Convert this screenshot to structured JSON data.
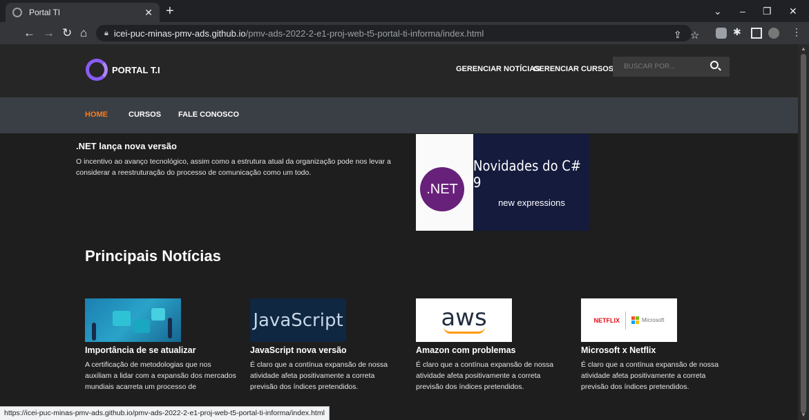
{
  "browser": {
    "tab_title": "Portal TI",
    "url_host": "icei-puc-minas-pmv-ads.github.io",
    "url_path": "/pmv-ads-2022-2-e1-proj-web-t5-portal-ti-informa/index.html",
    "status_url": "https://icei-puc-minas-pmv-ads.github.io/pmv-ads-2022-2-e1-proj-web-t5-portal-ti-informa/index.html"
  },
  "header": {
    "logo_text": "PORTAL T.I",
    "links": [
      "GERENCIAR NOTÍCIAS",
      "GERENCIAR CURSOS"
    ],
    "search_placeholder": "BUSCAR POR..."
  },
  "subnav": {
    "items": [
      "HOME",
      "CURSOS",
      "FALE CONOSCO"
    ],
    "active": "HOME"
  },
  "feature": {
    "title": ".NET lança nova versão",
    "text": "O incentivo ao avanço tecnológico, assim como a estrutura atual da organização pode nos levar a considerar a reestruturação do processo de comunicação como um todo."
  },
  "banner": {
    "badge": ".NET",
    "title": "Novidades do C# 9",
    "subtitle": "new expressions"
  },
  "section_title": "Principais Notícias",
  "cards": [
    {
      "title": "Importância de se atualizar",
      "text": "A certificação de metodologias que nos auxiliam a lidar com a expansão dos mercados mundiais acarreta um processo de"
    },
    {
      "title": "JavaScript nova versão",
      "image_text": "JavaScript",
      "text": "É claro que a contínua expansão de nossa atividade afeta positivamente a correta previsão dos índices pretendidos."
    },
    {
      "title": "Amazon com problemas",
      "image_text": "aws",
      "text": "É claro que a contínua expansão de nossa atividade afeta positivamente a correta previsão dos índices pretendidos."
    },
    {
      "title": "Microsoft x Netflix",
      "image_text_1": "NETFLIX",
      "image_text_2": "Microsoft",
      "text": "É claro que a contínua expansão de nossa atividade afeta positivamente a correta previsão dos índices pretendidos."
    }
  ],
  "colors": {
    "accent": "#ff7a1a",
    "header_bg": "#262626",
    "subnav_bg": "#3a3f45",
    "page_bg": "#1e1e1e",
    "logo_purple": "#8a5cf6"
  }
}
